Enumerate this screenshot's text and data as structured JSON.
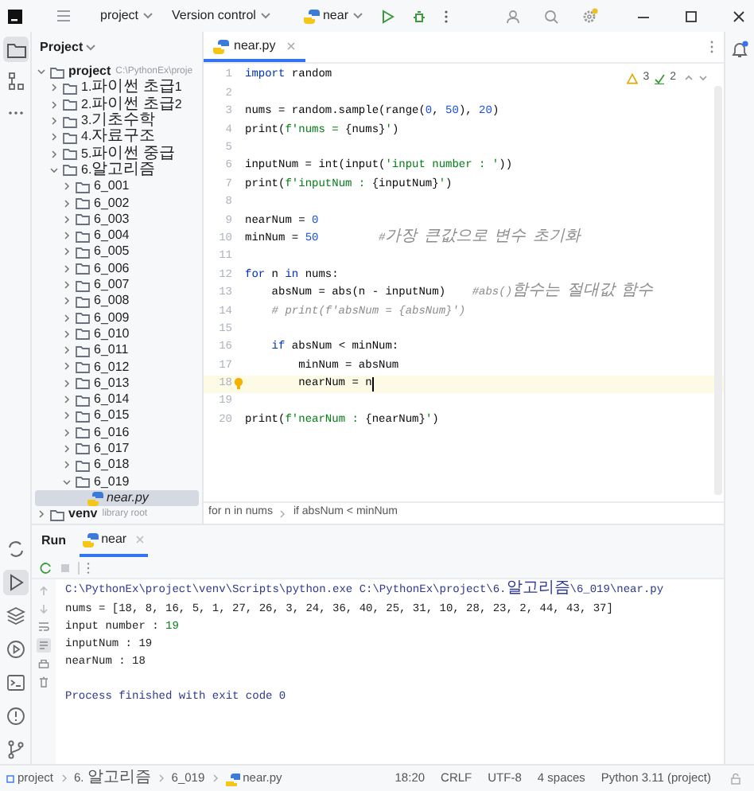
{
  "title_bar": {
    "project": "project",
    "vcs": "Version control",
    "run_config": "near"
  },
  "tool_windows": [
    {
      "kind": "project",
      "selected": true
    },
    {
      "kind": "structure",
      "selected": false
    },
    {
      "kind": "more",
      "selected": false
    },
    {
      "kind": "packages",
      "selected": false
    },
    {
      "kind": "run",
      "selected": true
    },
    {
      "kind": "layers",
      "selected": false
    },
    {
      "kind": "services",
      "selected": false
    },
    {
      "kind": "terminal",
      "selected": false
    },
    {
      "kind": "problems",
      "selected": false
    },
    {
      "kind": "git",
      "selected": false
    }
  ],
  "project_panel": {
    "title": "Project",
    "tree": [
      {
        "label": "project",
        "detail": "C:\\PythonEx\\proje",
        "kind": "folder",
        "expanded": true,
        "selected": false,
        "children": [
          {
            "label": "1.파이썬 초급1",
            "kind": "folder",
            "expanded": false,
            "selected": false
          },
          {
            "label": "2.파이썬 초급2",
            "kind": "folder",
            "expanded": false,
            "selected": false
          },
          {
            "label": "3.기초수학",
            "kind": "folder",
            "expanded": false,
            "selected": false
          },
          {
            "label": "4.자료구조",
            "kind": "folder",
            "expanded": false,
            "selected": false
          },
          {
            "label": "5.파이썬 중급",
            "kind": "folder",
            "expanded": false,
            "selected": false
          },
          {
            "label": "6.알고리즘",
            "kind": "folder",
            "expanded": true,
            "selected": false,
            "children": [
              {
                "label": "6_001",
                "kind": "folder",
                "expanded": false,
                "selected": false
              },
              {
                "label": "6_002",
                "kind": "folder",
                "expanded": false,
                "selected": false
              },
              {
                "label": "6_003",
                "kind": "folder",
                "expanded": false,
                "selected": false
              },
              {
                "label": "6_004",
                "kind": "folder",
                "expanded": false,
                "selected": false
              },
              {
                "label": "6_005",
                "kind": "folder",
                "expanded": false,
                "selected": false
              },
              {
                "label": "6_006",
                "kind": "folder",
                "expanded": false,
                "selected": false
              },
              {
                "label": "6_007",
                "kind": "folder",
                "expanded": false,
                "selected": false
              },
              {
                "label": "6_008",
                "kind": "folder",
                "expanded": false,
                "selected": false
              },
              {
                "label": "6_009",
                "kind": "folder",
                "expanded": false,
                "selected": false
              },
              {
                "label": "6_010",
                "kind": "folder",
                "expanded": false,
                "selected": false
              },
              {
                "label": "6_011",
                "kind": "folder",
                "expanded": false,
                "selected": false
              },
              {
                "label": "6_012",
                "kind": "folder",
                "expanded": false,
                "selected": false
              },
              {
                "label": "6_013",
                "kind": "folder",
                "expanded": false,
                "selected": false
              },
              {
                "label": "6_014",
                "kind": "folder",
                "expanded": false,
                "selected": false
              },
              {
                "label": "6_015",
                "kind": "folder",
                "expanded": false,
                "selected": false
              },
              {
                "label": "6_016",
                "kind": "folder",
                "expanded": false,
                "selected": false
              },
              {
                "label": "6_017",
                "kind": "folder",
                "expanded": false,
                "selected": false
              },
              {
                "label": "6_018",
                "kind": "folder",
                "expanded": false,
                "selected": false
              },
              {
                "label": "6_019",
                "kind": "folder",
                "expanded": true,
                "selected": false,
                "children": [
                  {
                    "label": "near.py",
                    "kind": "file",
                    "selected": true
                  }
                ]
              }
            ]
          }
        ]
      },
      {
        "label": "venv",
        "detail": "library root",
        "kind": "folder",
        "expanded": false,
        "selected": false
      }
    ]
  },
  "editor": {
    "tab": {
      "label": "near.py",
      "selected": true
    },
    "inspections": {
      "warnings": "3",
      "checks": "2"
    },
    "lines": [
      {
        "number": "1",
        "current": false,
        "tokens": [
          {
            "kind": "keyword",
            "text": "import"
          },
          {
            "kind": "plain",
            "text": " random"
          }
        ]
      },
      {
        "number": "2",
        "current": false
      },
      {
        "number": "3",
        "current": false,
        "tokens": [
          {
            "kind": "plain",
            "text": "nums = random.sample(range("
          },
          {
            "kind": "number",
            "text": "0"
          },
          {
            "kind": "plain",
            "text": ", "
          },
          {
            "kind": "number",
            "text": "50"
          },
          {
            "kind": "plain",
            "text": "), "
          },
          {
            "kind": "number",
            "text": "20"
          },
          {
            "kind": "plain",
            "text": ")"
          }
        ]
      },
      {
        "number": "4",
        "current": false,
        "tokens": [
          {
            "kind": "plain",
            "text": "print("
          },
          {
            "kind": "string",
            "text": "f'nums = "
          },
          {
            "kind": "plain",
            "text": "{nums}"
          },
          {
            "kind": "string",
            "text": "'"
          },
          {
            "kind": "plain",
            "text": ")"
          }
        ]
      },
      {
        "number": "5",
        "current": false
      },
      {
        "number": "6",
        "current": false,
        "tokens": [
          {
            "kind": "plain",
            "text": "inputNum = int(input("
          },
          {
            "kind": "string",
            "text": "'input number : '"
          },
          {
            "kind": "plain",
            "text": "))"
          }
        ]
      },
      {
        "number": "7",
        "current": false,
        "tokens": [
          {
            "kind": "plain",
            "text": "print("
          },
          {
            "kind": "string",
            "text": "f'inputNum : "
          },
          {
            "kind": "plain",
            "text": "{inputNum}"
          },
          {
            "kind": "string",
            "text": "'"
          },
          {
            "kind": "plain",
            "text": ")"
          }
        ]
      },
      {
        "number": "8",
        "current": false
      },
      {
        "number": "9",
        "current": false,
        "tokens": [
          {
            "kind": "plain",
            "text": "nearNum = "
          },
          {
            "kind": "number",
            "text": "0"
          }
        ]
      },
      {
        "number": "10",
        "current": false,
        "tokens": [
          {
            "kind": "plain",
            "text": "minNum = "
          },
          {
            "kind": "number",
            "text": "50"
          },
          {
            "kind": "comment",
            "text": "         #가장 큰값으로 변수 초기화"
          }
        ]
      },
      {
        "number": "11",
        "current": false
      },
      {
        "number": "12",
        "current": false,
        "tokens": [
          {
            "kind": "keyword",
            "text": "for"
          },
          {
            "kind": "plain",
            "text": " n "
          },
          {
            "kind": "keyword",
            "text": "in"
          },
          {
            "kind": "plain",
            "text": " nums:"
          }
        ]
      },
      {
        "number": "13",
        "current": false,
        "tokens": [
          {
            "kind": "plain",
            "text": "    absNum = abs(n - inputNum)    "
          },
          {
            "kind": "comment",
            "text": "#abs()함수는 절대값 함수"
          }
        ]
      },
      {
        "number": "14",
        "current": false,
        "tokens": [
          {
            "kind": "comment",
            "text": "    # print(f'absNum = {absNum}')"
          }
        ]
      },
      {
        "number": "15",
        "current": false
      },
      {
        "number": "16",
        "current": false,
        "tokens": [
          {
            "kind": "keyword",
            "text": "    if"
          },
          {
            "kind": "plain",
            "text": " absNum < minNum:"
          }
        ]
      },
      {
        "number": "17",
        "current": false,
        "tokens": [
          {
            "kind": "plain",
            "text": "        minNum = absNum"
          }
        ]
      },
      {
        "number": "18",
        "current": true,
        "tokens": [
          {
            "kind": "plain",
            "text": "        nearNum = n"
          }
        ]
      },
      {
        "number": "19",
        "current": false
      },
      {
        "number": "20",
        "current": false,
        "tokens": [
          {
            "kind": "plain",
            "text": "print("
          },
          {
            "kind": "string",
            "text": "f'nearNum : "
          },
          {
            "kind": "plain",
            "text": "{nearNum}"
          },
          {
            "kind": "string",
            "text": "'"
          },
          {
            "kind": "plain",
            "text": ")"
          }
        ]
      }
    ],
    "breadcrumbs": [
      "for n in nums",
      "if absNum < minNum"
    ]
  },
  "run_panel": {
    "title": "Run",
    "tab": "near",
    "output": [
      {
        "kind": "text",
        "segments": [
          {
            "kind": "command",
            "text": "C:\\PythonEx\\project\\venv\\Scripts\\python.exe C:\\PythonEx\\project\\6.알고리즘\\6_019\\near.py"
          }
        ]
      },
      {
        "kind": "text",
        "segments": [
          {
            "kind": "stdout",
            "text": "nums = [18, 8, 16, 5, 1, 27, 26, 3, 24, 36, 40, 25, 31, 10, 28, 23, 2, 44, 43, 37]"
          }
        ]
      },
      {
        "kind": "text",
        "segments": [
          {
            "kind": "stdout",
            "text": "input number : "
          },
          {
            "kind": "stdin",
            "text": "19"
          }
        ]
      },
      {
        "kind": "text",
        "segments": [
          {
            "kind": "stdout",
            "text": "inputNum : 19"
          }
        ]
      },
      {
        "kind": "text",
        "segments": [
          {
            "kind": "stdout",
            "text": "nearNum : 18"
          }
        ]
      },
      {
        "kind": "blank"
      },
      {
        "kind": "text",
        "segments": [
          {
            "kind": "command",
            "text": "Process finished with exit code 0"
          }
        ]
      }
    ]
  },
  "status_bar": {
    "path": [
      "project",
      "6.알고리즘",
      "6_019",
      "near.py"
    ],
    "items": [
      "18:20",
      "CRLF",
      "UTF-8",
      "4 spaces",
      "Python 3.11 (project)"
    ]
  }
}
